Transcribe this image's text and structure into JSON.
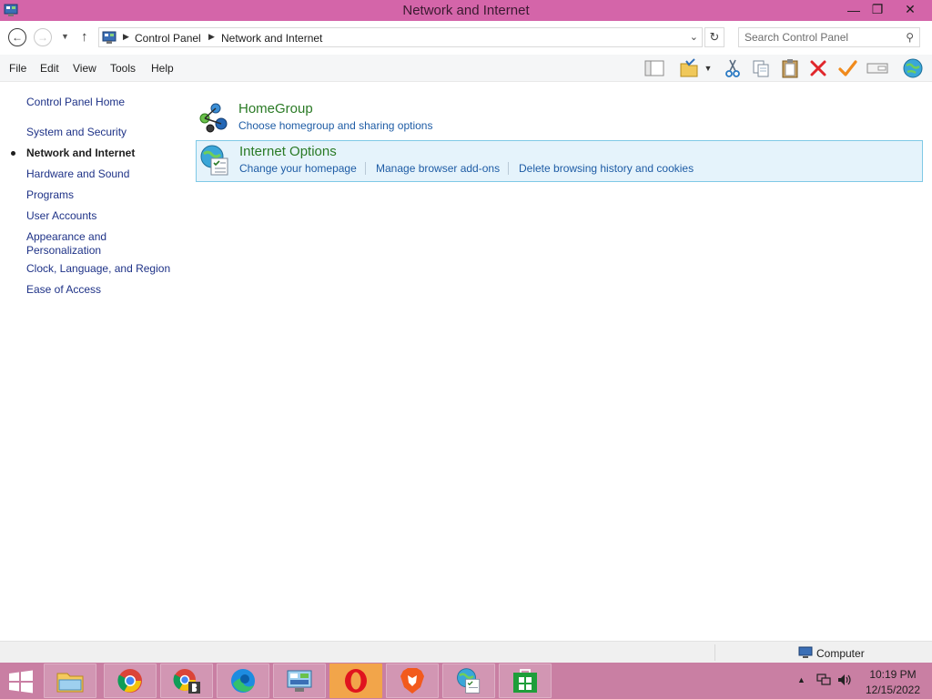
{
  "window": {
    "title": "Network and Internet",
    "minimize_glyph": "—",
    "maximize_glyph": "❐",
    "close_glyph": "✕"
  },
  "address": {
    "crumbs": [
      "Control Panel",
      "Network and Internet"
    ],
    "search_placeholder": "Search Control Panel"
  },
  "menu": [
    "File",
    "Edit",
    "View",
    "Tools",
    "Help"
  ],
  "toolbar_icons": [
    "layout-icon",
    "folder-options-icon",
    "cut-icon",
    "copy-icon",
    "paste-icon",
    "delete-icon",
    "check-icon",
    "properties-icon",
    "globe-icon"
  ],
  "sidebar": {
    "home": "Control Panel Home",
    "items": [
      "System and Security",
      "Network and Internet",
      "Hardware and Sound",
      "Programs",
      "User Accounts",
      "Appearance and Personalization",
      "Clock, Language, and Region",
      "Ease of Access"
    ],
    "active_index": 1
  },
  "categories": [
    {
      "title": "HomeGroup",
      "links": [
        "Choose homegroup and sharing options"
      ]
    },
    {
      "title": "Internet Options",
      "links": [
        "Change your homepage",
        "Manage browser add-ons",
        "Delete browsing history and cookies"
      ]
    }
  ],
  "status": {
    "location": "Computer"
  },
  "taskbar": {
    "apps": [
      "file-explorer",
      "chrome",
      "chrome-beta",
      "edge",
      "control-panel",
      "opera",
      "brave",
      "internet-options",
      "store"
    ],
    "time": "10:19 PM",
    "date": "12/15/2022"
  },
  "colors": {
    "titlebar": "#d465a9",
    "taskbar": "#c97fa3",
    "link": "#1e5ca5",
    "category_title": "#2a7a25",
    "selected_bg": "#e5f3fb",
    "selected_border": "#7fc9e6"
  }
}
